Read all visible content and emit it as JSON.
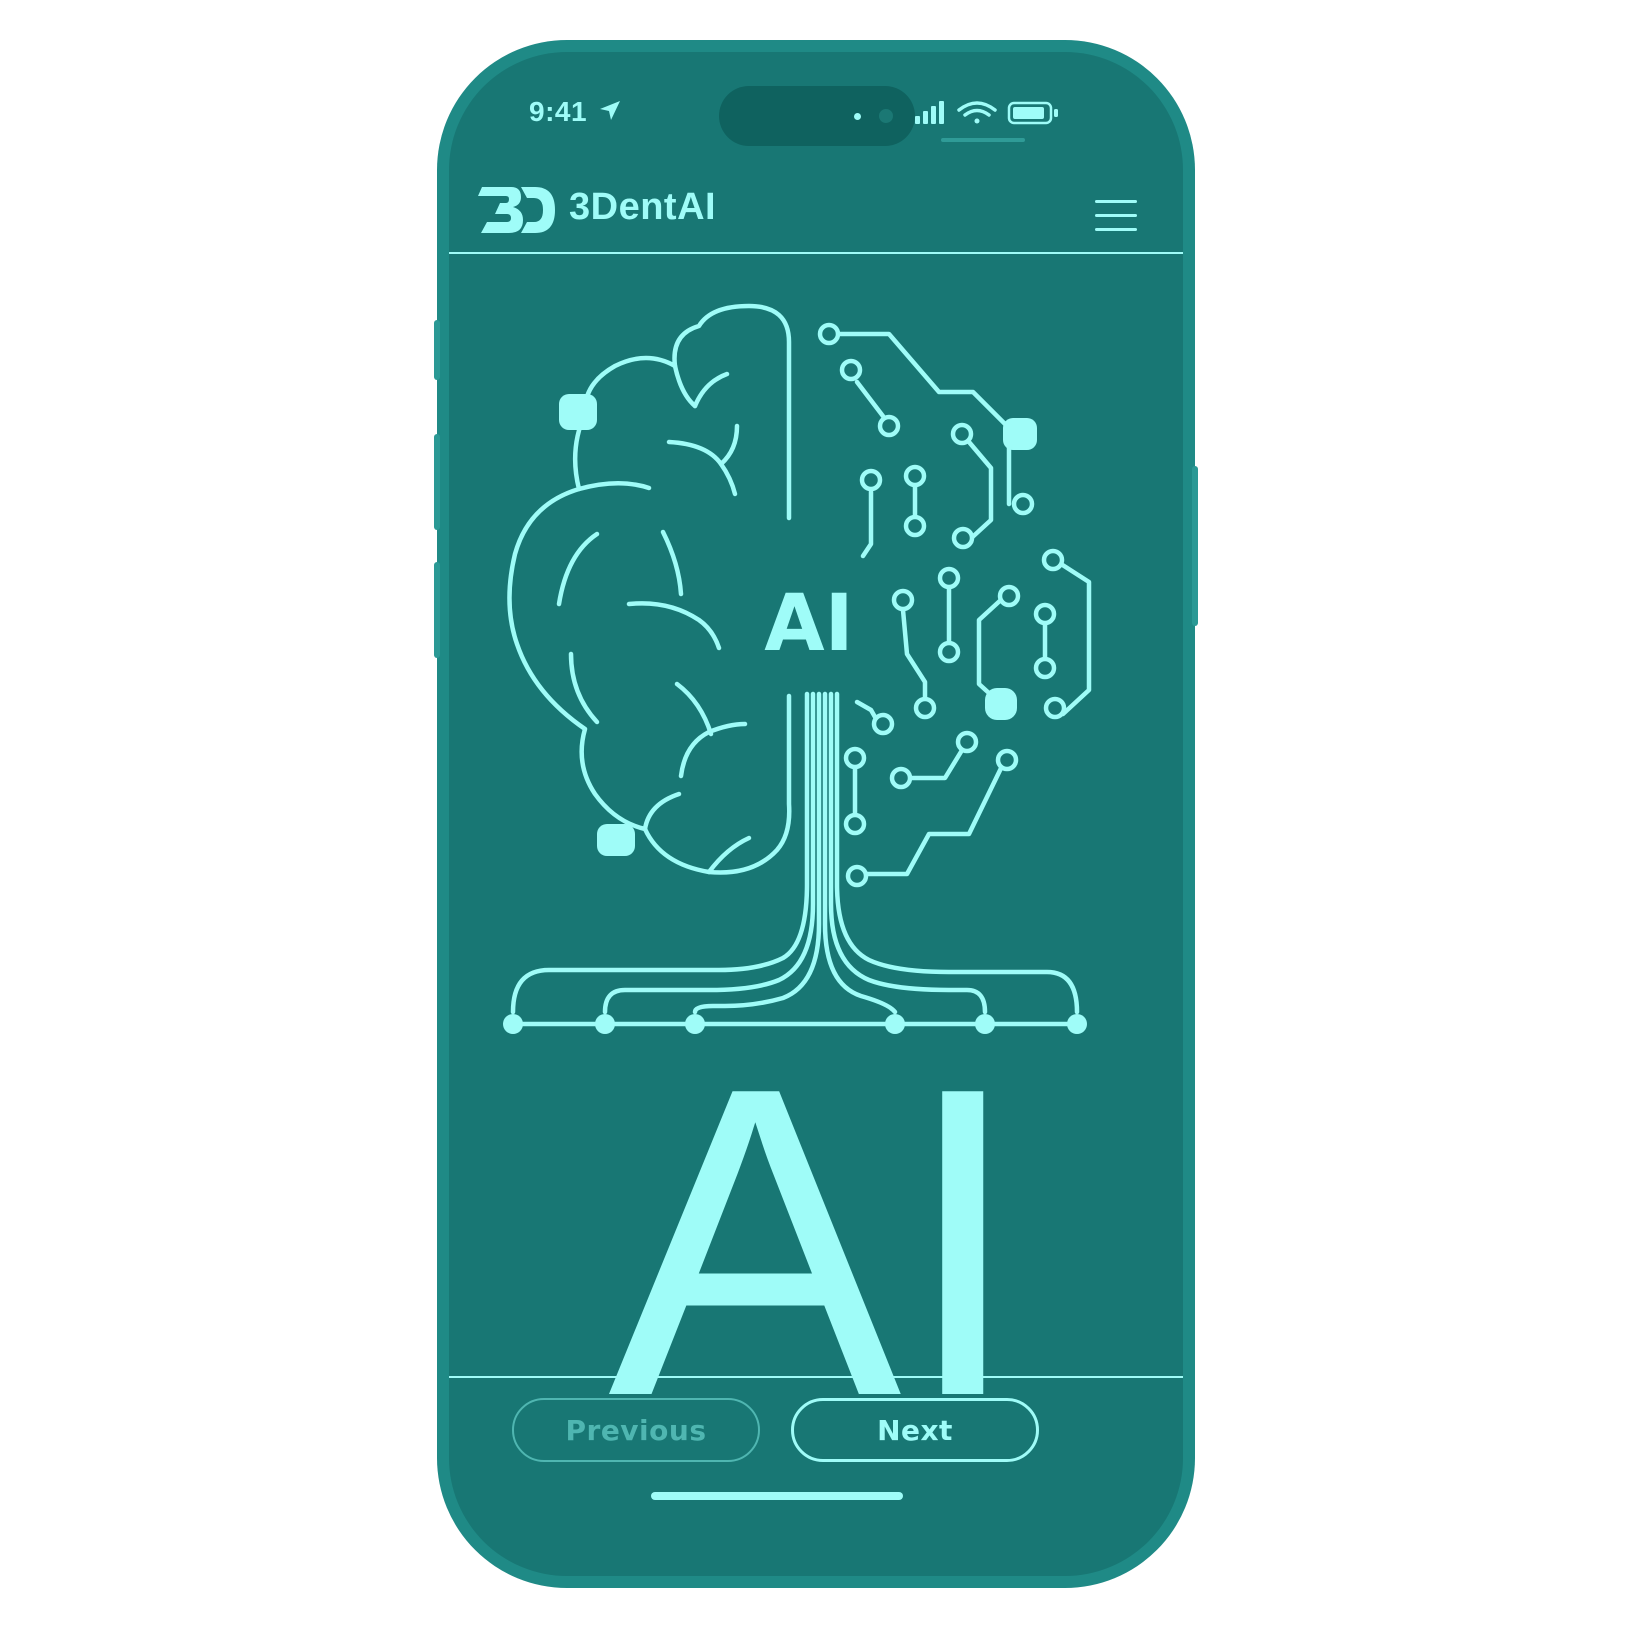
{
  "status_bar": {
    "time": "9:41",
    "icons": [
      "location-arrow-icon",
      "cellular-signal-icon",
      "wifi-icon",
      "battery-icon"
    ]
  },
  "header": {
    "brand_name": "3DentAI",
    "logo_icon": "3d-tooth-logo",
    "menu_icon": "hamburger-menu-icon"
  },
  "hero": {
    "brain_label": "AI",
    "big_label": "AI"
  },
  "footer": {
    "previous_label": "Previous",
    "next_label": "Next"
  },
  "colors": {
    "accent": "#9ffcf8",
    "background": "#187774",
    "frame": "#1f8a86",
    "muted": "#4fb6b1"
  }
}
